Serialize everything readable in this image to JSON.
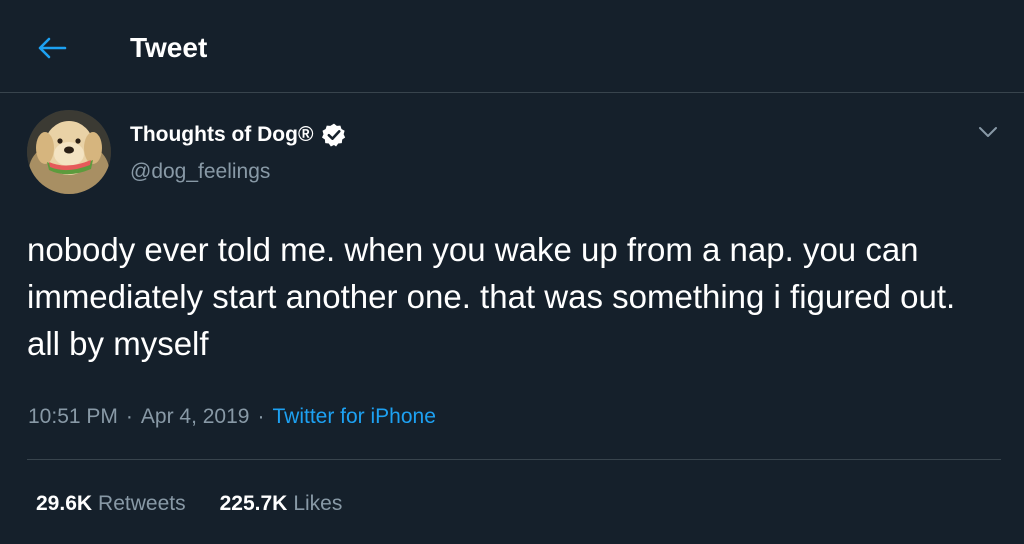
{
  "header": {
    "title": "Tweet",
    "back_icon": "arrow-left-icon"
  },
  "author": {
    "display_name": "Thoughts of Dog®",
    "handle": "@dog_feelings",
    "verified_icon": "verified-badge-icon"
  },
  "tweet": {
    "text": "nobody ever told me. when you wake up from a nap. you can immediately start another one. that was something i figured out. all by myself",
    "time": "10:51 PM",
    "date": "Apr 4, 2019",
    "separator": "·",
    "source": "Twitter for iPhone"
  },
  "stats": {
    "retweets_count": "29.6K",
    "retweets_label": "Retweets",
    "likes_count": "225.7K",
    "likes_label": "Likes"
  },
  "colors": {
    "background": "#15202b",
    "accent": "#1da1f2",
    "secondary_text": "#8899a6",
    "border": "#38444d"
  }
}
